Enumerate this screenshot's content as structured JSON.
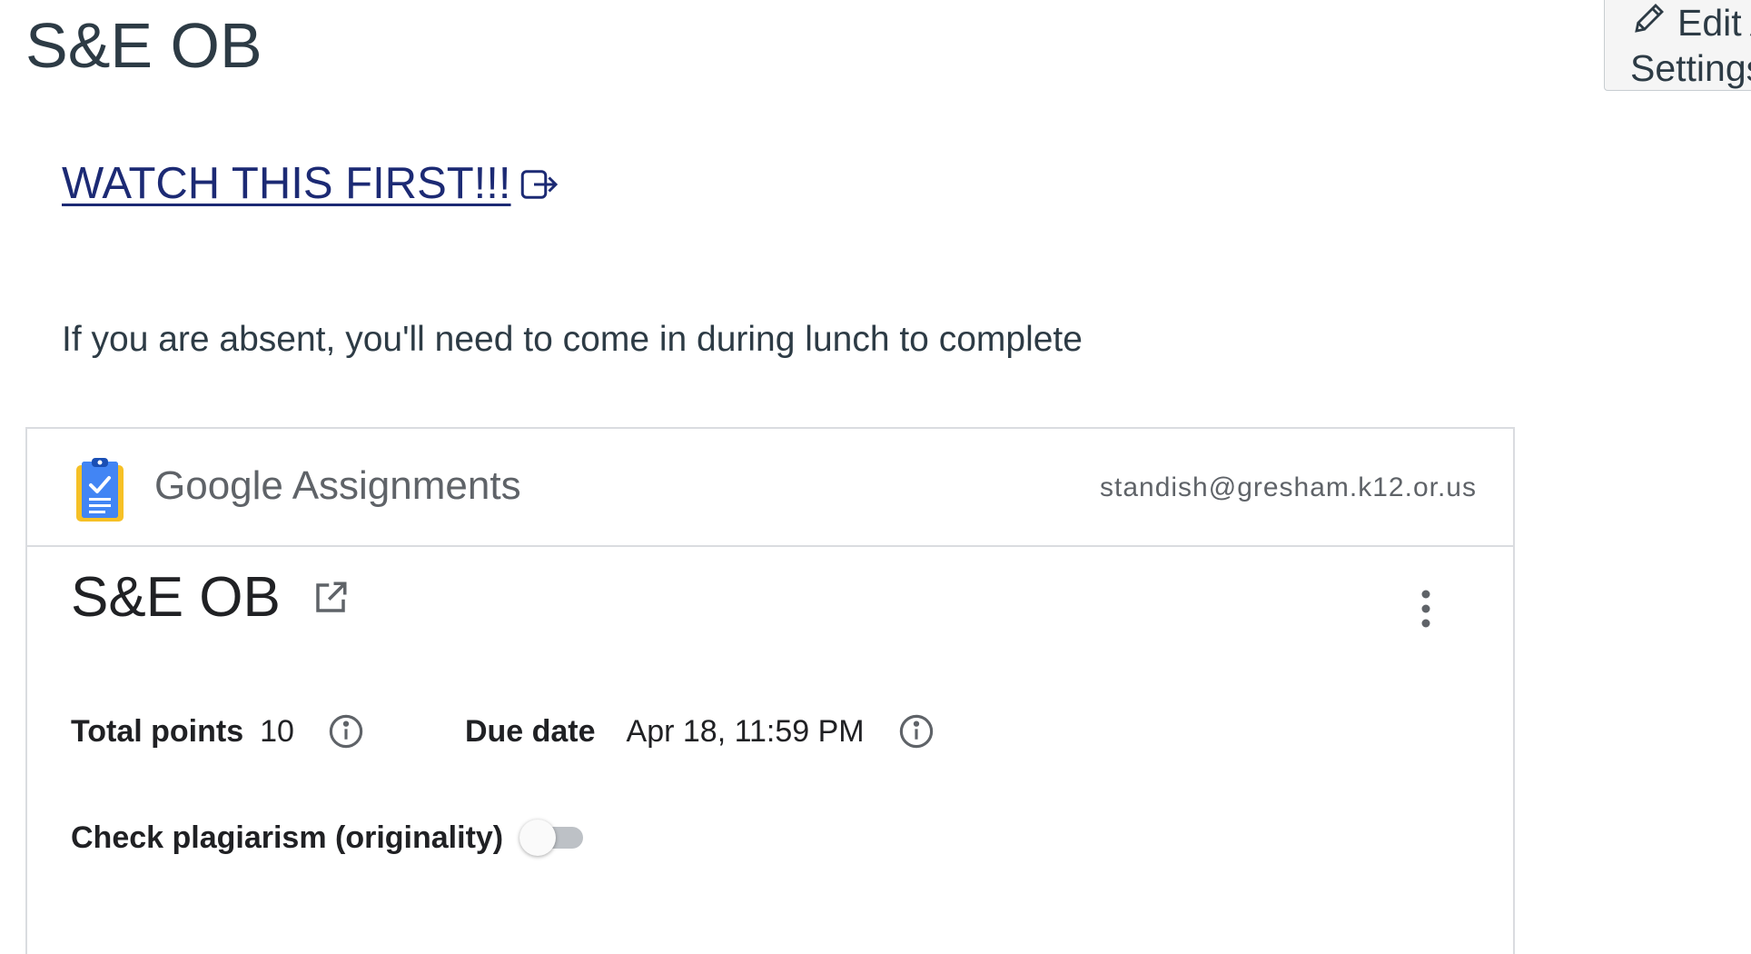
{
  "page": {
    "title": "S&E OB",
    "edit_button": {
      "line1": "Edit A",
      "line2": "Settings",
      "icon": "pencil-icon"
    }
  },
  "content": {
    "link_text": "WATCH THIS FIRST!!!",
    "link_icon": "external-link-icon",
    "absent_note": "If you are absent, you'll need to come in during lunch to complete"
  },
  "google_assignments": {
    "brand_google": "Google",
    "brand_product": "Assignments",
    "account_email": "standish@gresham.k12.or.us",
    "assignment_title": "S&E OB",
    "total_points_label": "Total points",
    "total_points_value": "10",
    "due_date_label": "Due date",
    "due_date_value": "Apr 18, 11:59 PM",
    "plagiarism_label": "Check plagiarism (originality)",
    "plagiarism_enabled": false,
    "colors": {
      "clipboard_yellow": "#f6c026",
      "clipboard_blue": "#1a73e8",
      "link_color": "#1c2a74"
    }
  }
}
